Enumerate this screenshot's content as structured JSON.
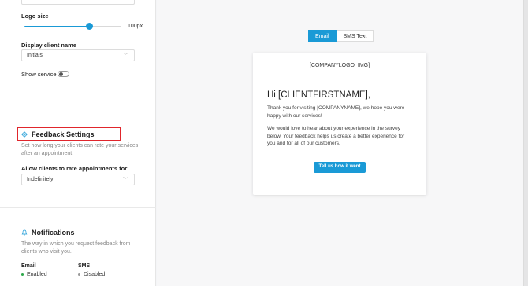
{
  "sidebar": {
    "logo_size_label": "Logo size",
    "logo_size_value": "100px",
    "logo_size_fraction": 0.67,
    "display_client_name_label": "Display client name",
    "display_client_name_value": "Initials",
    "show_service_label": "Show service",
    "show_service_enabled": false,
    "feedback": {
      "title": "Feedback Settings",
      "icon": "gear-icon",
      "description": "Set how long your clients can rate your services after an appointment",
      "rate_label": "Allow clients to rate appointments for:",
      "rate_value": "Indefinitely"
    },
    "notifications": {
      "title": "Notifications",
      "icon": "bell-icon",
      "description": "The way in which you request feedback from clients who visit you.",
      "email_label": "Email",
      "email_status": "Enabled",
      "sms_label": "SMS",
      "sms_status": "Disabled"
    }
  },
  "preview": {
    "tabs": [
      "Email",
      "SMS Text"
    ],
    "active_tab": "Email",
    "logo_placeholder": "[COMPANYLOGO_IMG]",
    "greeting": "Hi [CLIENTFIRSTNAME],",
    "paragraph1": "Thank you for visiting [COMPANYNAME], we hope you were happy with our services!",
    "paragraph2": "We would love to hear about your experience in the survey below. Your feedback helps us create a better experience for you and for all of our customers.",
    "button_label": "Tell us how it went"
  },
  "colors": {
    "accent": "#1a9ad6",
    "highlight": "#e0262c",
    "enabled": "#2ea84a",
    "disabled": "#9a9a9a"
  }
}
